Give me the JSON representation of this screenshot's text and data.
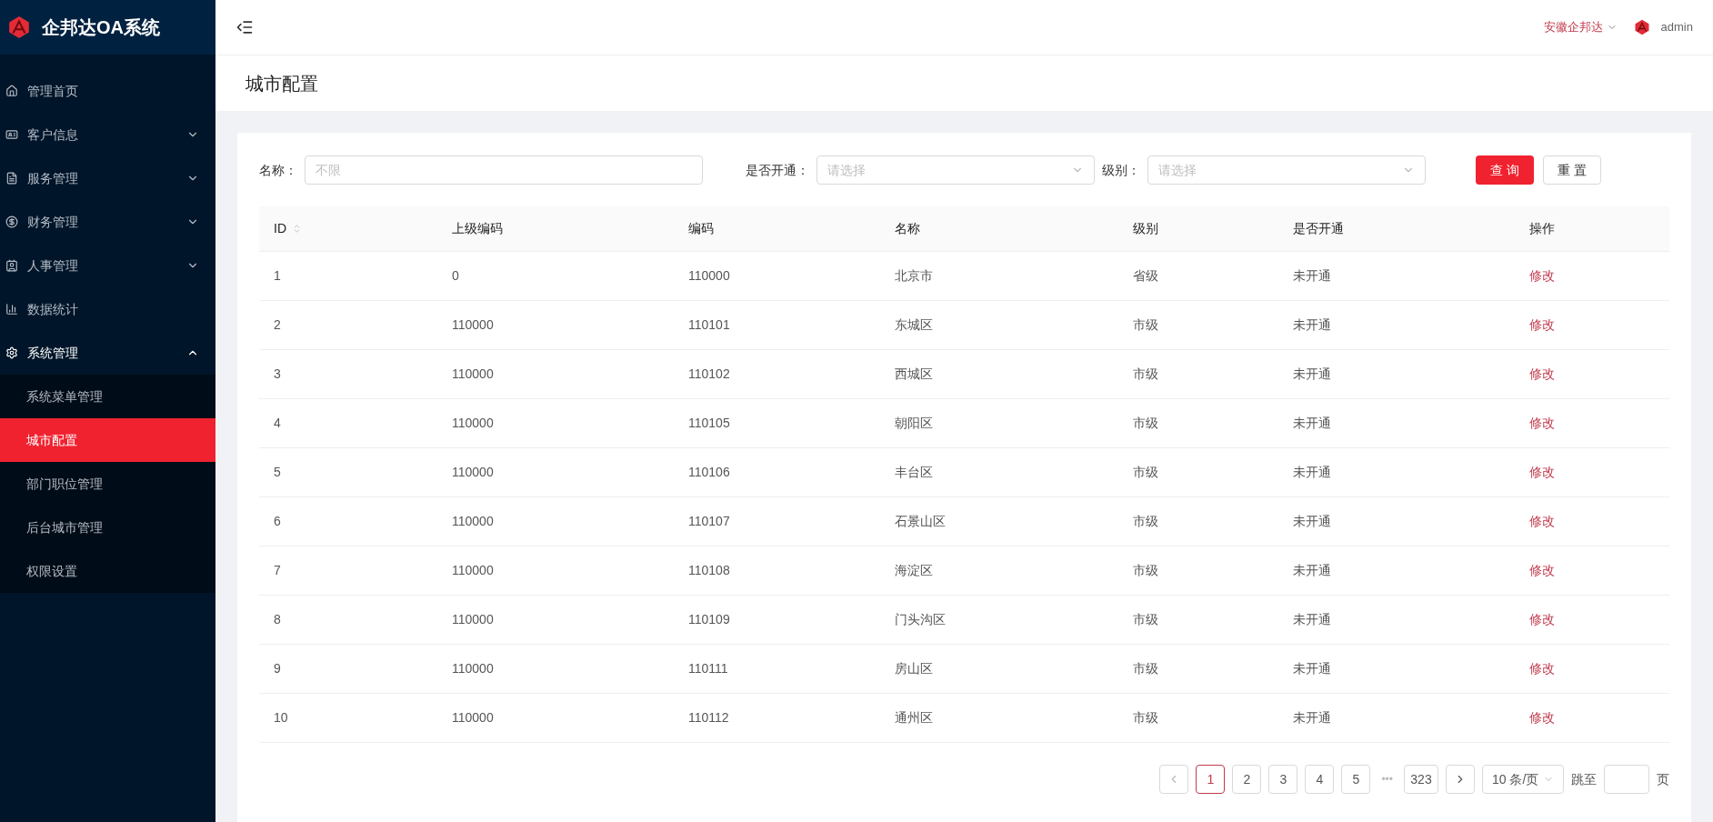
{
  "brand": {
    "title": "企邦达OA系统"
  },
  "sidebar": {
    "items": [
      {
        "label": "管理首页"
      },
      {
        "label": "客户信息",
        "expanded": false
      },
      {
        "label": "服务管理",
        "expanded": false
      },
      {
        "label": "财务管理",
        "expanded": false
      },
      {
        "label": "人事管理",
        "expanded": false
      },
      {
        "label": "数据统计"
      },
      {
        "label": "系统管理",
        "expanded": true,
        "children": [
          {
            "label": "系统菜单管理",
            "selected": false
          },
          {
            "label": "城市配置",
            "selected": true
          },
          {
            "label": "部门职位管理",
            "selected": false
          },
          {
            "label": "后台城市管理",
            "selected": false
          },
          {
            "label": "权限设置",
            "selected": false
          }
        ]
      }
    ]
  },
  "header": {
    "company": "安徽企邦达",
    "user": "admin"
  },
  "page_title": "城市配置",
  "filters": [
    {
      "kind": "text",
      "label": "名称：",
      "placeholder": "不限"
    },
    {
      "kind": "select",
      "label": "是否开通：",
      "placeholder": "请选择"
    },
    {
      "kind": "select",
      "label": "级别：",
      "placeholder": "请选择"
    }
  ],
  "buttons": {
    "search": "查 询",
    "reset": "重 置"
  },
  "table": {
    "columns": [
      "ID",
      "上级编码",
      "编码",
      "名称",
      "级别",
      "是否开通",
      "操作"
    ],
    "rows": [
      [
        "1",
        "0",
        "110000",
        "北京市",
        "省级",
        "未开通",
        "修改"
      ],
      [
        "2",
        "110000",
        "110101",
        "东城区",
        "市级",
        "未开通",
        "修改"
      ],
      [
        "3",
        "110000",
        "110102",
        "西城区",
        "市级",
        "未开通",
        "修改"
      ],
      [
        "4",
        "110000",
        "110105",
        "朝阳区",
        "市级",
        "未开通",
        "修改"
      ],
      [
        "5",
        "110000",
        "110106",
        "丰台区",
        "市级",
        "未开通",
        "修改"
      ],
      [
        "6",
        "110000",
        "110107",
        "石景山区",
        "市级",
        "未开通",
        "修改"
      ],
      [
        "7",
        "110000",
        "110108",
        "海淀区",
        "市级",
        "未开通",
        "修改"
      ],
      [
        "8",
        "110000",
        "110109",
        "门头沟区",
        "市级",
        "未开通",
        "修改"
      ],
      [
        "9",
        "110000",
        "110111",
        "房山区",
        "市级",
        "未开通",
        "修改"
      ],
      [
        "10",
        "110000",
        "110112",
        "通州区",
        "市级",
        "未开通",
        "修改"
      ]
    ]
  },
  "pagination": {
    "pages": [
      {
        "label": "1",
        "selected": true
      },
      {
        "label": "2",
        "selected": false
      },
      {
        "label": "3",
        "selected": false
      },
      {
        "label": "4",
        "selected": false
      },
      {
        "label": "5",
        "selected": false
      }
    ],
    "ellipsis": "•••",
    "last": "323",
    "page_size": "10 条/页",
    "jump_label": "跳至",
    "jump_suffix": "页"
  }
}
